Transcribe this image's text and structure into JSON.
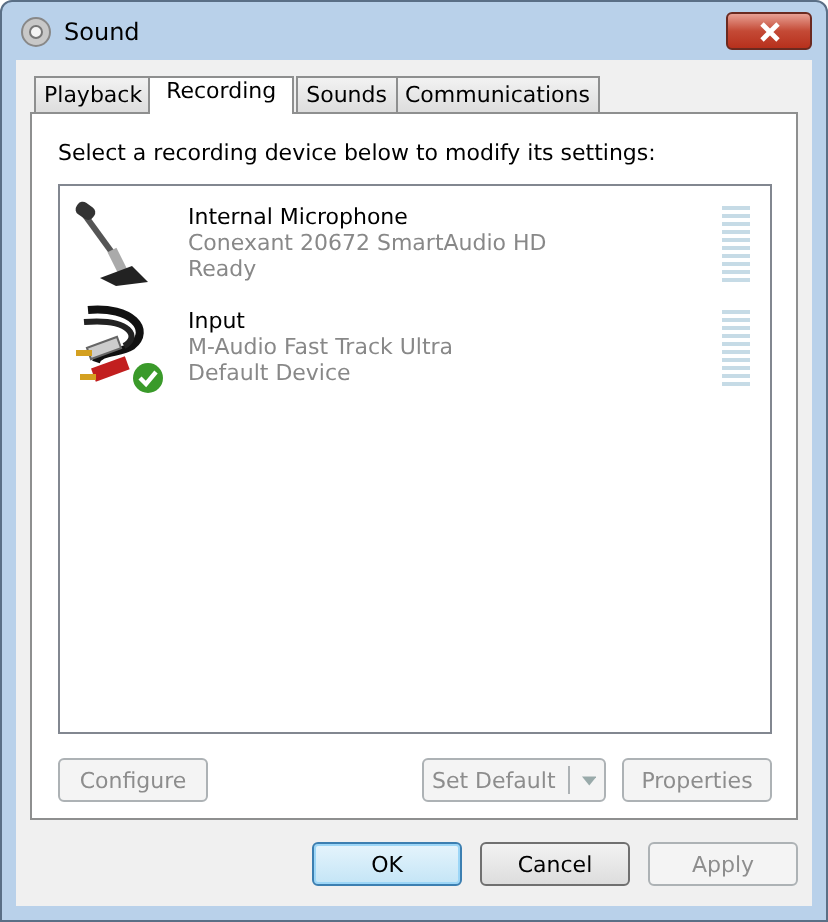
{
  "window": {
    "title": "Sound"
  },
  "tabs": [
    {
      "label": "Playback",
      "selected": false
    },
    {
      "label": "Recording",
      "selected": true
    },
    {
      "label": "Sounds",
      "selected": false
    },
    {
      "label": "Communications",
      "selected": false
    }
  ],
  "instruction": "Select a recording device below to modify its settings:",
  "devices": [
    {
      "kind": "microphone",
      "name": "Internal Microphone",
      "driver": "Conexant 20672 SmartAudio HD",
      "status": "Ready",
      "default": false,
      "level": 0
    },
    {
      "kind": "line",
      "name": "Input",
      "driver": "M-Audio Fast Track Ultra",
      "status": "Default Device",
      "default": true,
      "level": 0
    }
  ],
  "panel_buttons": [
    {
      "label": "Configure",
      "disabled": true,
      "dropdown": false
    },
    {
      "label": "Set Default",
      "disabled": true,
      "dropdown": true
    },
    {
      "label": "Properties",
      "disabled": true,
      "dropdown": false
    }
  ],
  "dialog_buttons": [
    {
      "label": "OK",
      "disabled": false,
      "default": true
    },
    {
      "label": "Cancel",
      "disabled": false,
      "default": false
    },
    {
      "label": "Apply",
      "disabled": true,
      "default": false
    }
  ]
}
